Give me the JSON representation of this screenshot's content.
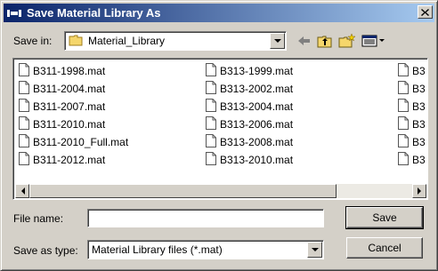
{
  "window": {
    "title": "Save Material Library As",
    "close_glyph": "✕"
  },
  "save_in": {
    "label": "Save in:",
    "value": "Material_Library"
  },
  "toolbar": {
    "icons": [
      "back-icon",
      "up-folder-icon",
      "new-folder-icon",
      "view-menu-icon"
    ]
  },
  "files": {
    "column1": [
      "B311-1998.mat",
      "B311-2004.mat",
      "B311-2007.mat",
      "B311-2010.mat",
      "B311-2010_Full.mat",
      "B311-2012.mat"
    ],
    "column2": [
      "B313-1999.mat",
      "B313-2002.mat",
      "B313-2004.mat",
      "B313-2006.mat",
      "B313-2008.mat",
      "B313-2010.mat"
    ],
    "column3": [
      "B3",
      "B3",
      "B3",
      "B3",
      "B3",
      "B3"
    ]
  },
  "file_name": {
    "label": "File name:",
    "value": ""
  },
  "save_as_type": {
    "label": "Save as type:",
    "value": "Material Library files (*.mat)"
  },
  "buttons": {
    "save": "Save",
    "cancel": "Cancel"
  },
  "colors": {
    "title_gradient_start": "#0a246a",
    "title_gradient_end": "#a6caf0",
    "face": "#d4d0c8"
  }
}
